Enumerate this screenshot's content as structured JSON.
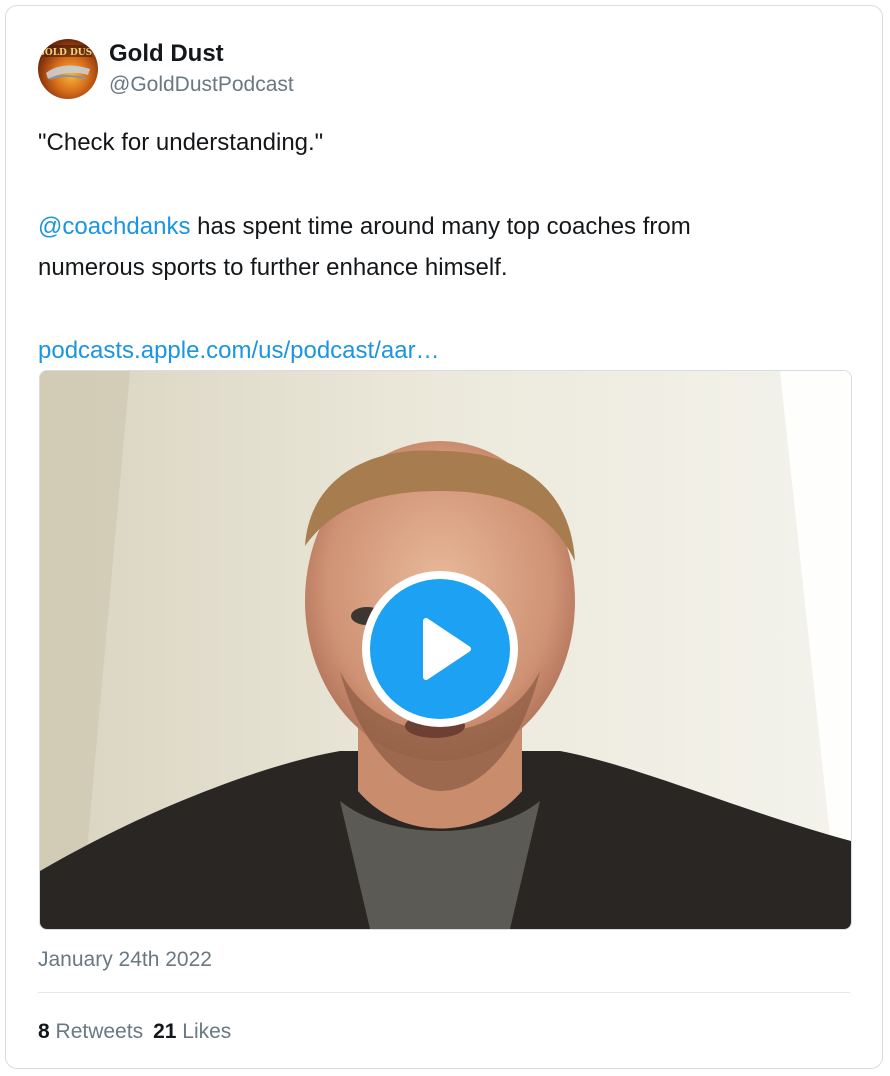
{
  "tweet": {
    "author_name": "Gold Dust",
    "author_handle": "@GoldDustPodcast",
    "avatar_text": "GOLD DUST",
    "line1": "\"Check for understanding.\"",
    "mention": "@coachdanks",
    "line2_rest": " has spent time around many top coaches from",
    "line3": "numerous sports to further enhance himself.",
    "link": "podcasts.apple.com/us/podcast/aar…",
    "date": "January 24th 2022",
    "retweets_count": "8",
    "retweets_label": "Retweets",
    "likes_count": "21",
    "likes_label": "Likes"
  },
  "icons": {
    "play": "play-icon"
  },
  "colors": {
    "link": "#1b95e0",
    "play_button": "#1da1f2",
    "secondary_text": "#697882"
  }
}
